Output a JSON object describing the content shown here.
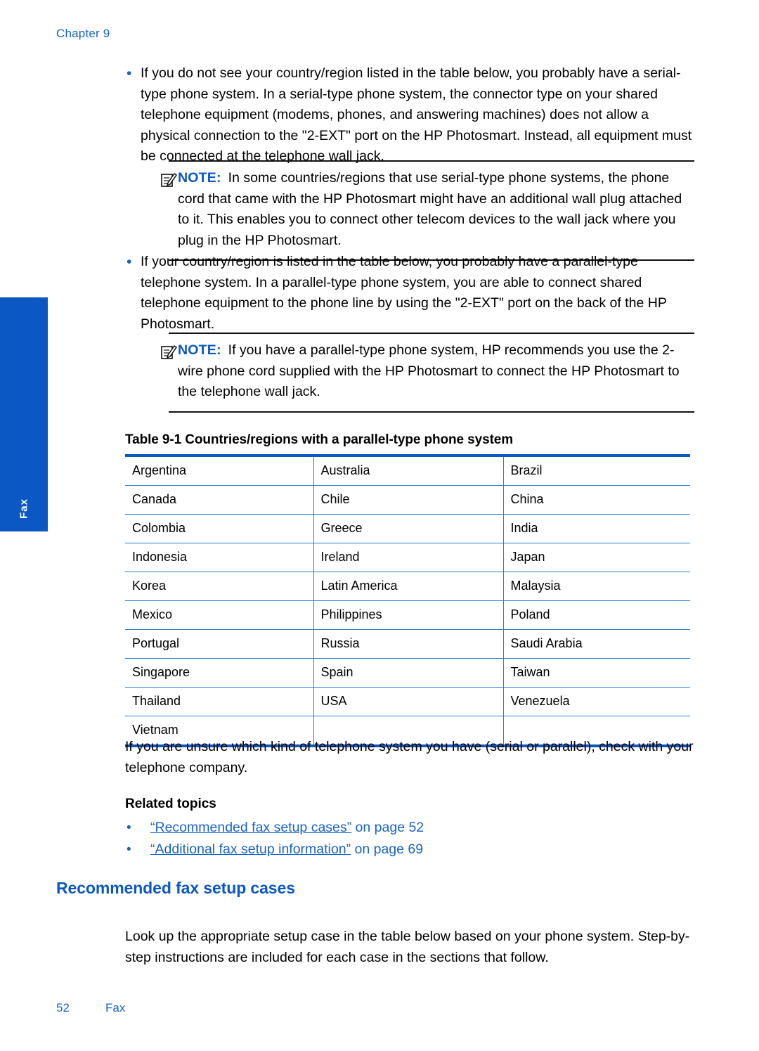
{
  "header": {
    "chapter": "Chapter 9"
  },
  "side_tab": {
    "label": "Fax"
  },
  "bullets": [
    {
      "text": "If you do not see your country/region listed in the table below, you probably have a serial-type phone system. In a serial-type phone system, the connector type on your shared telephone equipment (modems, phones, and answering machines) does not allow a physical connection to the \"2-EXT\" port on the HP Photosmart. Instead, all equipment must be connected at the telephone wall jack.",
      "marker": "•"
    },
    {
      "text": "If your country/region is listed in the table below, you probably have a parallel-type telephone system. In a parallel-type phone system, you are able to connect shared telephone equipment to the phone line by using the \"2-EXT\" port on the back of the HP Photosmart.",
      "marker": "•"
    }
  ],
  "notes": [
    {
      "label": "NOTE:",
      "text": "In some countries/regions that use serial-type phone systems, the phone cord that came with the HP Photosmart might have an additional wall plug attached to it. This enables you to connect other telecom devices to the wall jack where you plug in the HP Photosmart."
    },
    {
      "label": "NOTE:",
      "text": "If you have a parallel-type phone system, HP recommends you use the 2-wire phone cord supplied with the HP Photosmart to connect the HP Photosmart to the telephone wall jack."
    }
  ],
  "table": {
    "caption": "Table 9-1 Countries/regions with a parallel-type phone system",
    "border_color": "#2b7ad4",
    "rule_color": "#0b57c4",
    "rows": [
      [
        "Argentina",
        "Australia",
        "Brazil"
      ],
      [
        "Canada",
        "Chile",
        "China"
      ],
      [
        "Colombia",
        "Greece",
        "India"
      ],
      [
        "Indonesia",
        "Ireland",
        "Japan"
      ],
      [
        "Korea",
        "Latin America",
        "Malaysia"
      ],
      [
        "Mexico",
        "Philippines",
        "Poland"
      ],
      [
        "Portugal",
        "Russia",
        "Saudi Arabia"
      ],
      [
        "Singapore",
        "Spain",
        "Taiwan"
      ],
      [
        "Thailand",
        "USA",
        "Venezuela"
      ],
      [
        "Vietnam",
        "",
        ""
      ]
    ]
  },
  "after_table_paragraph": "If you are unsure which kind of telephone system you have (serial or parallel), check with your telephone company.",
  "related": {
    "heading": "Related topics",
    "links": [
      {
        "marker": "•",
        "quoted": "“Recommended fax setup cases”",
        "suffix": " on page 52"
      },
      {
        "marker": "•",
        "quoted": "“Additional fax setup information”",
        "suffix": " on page 69"
      }
    ]
  },
  "section": {
    "heading": "Recommended fax setup cases",
    "paragraph": "Look up the appropriate setup case in the table below based on your phone system. Step-by-step instructions are included for each case in the sections that follow."
  },
  "footer": {
    "page_number": "52",
    "section_name": "Fax"
  },
  "colors": {
    "link_blue": "#1763c6",
    "heading_blue": "#0b57c4",
    "tab_blue": "#0b57c4"
  }
}
